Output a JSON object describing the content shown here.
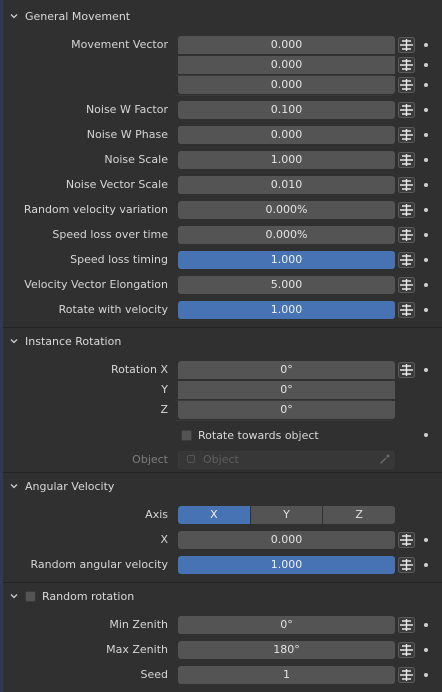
{
  "sections": {
    "general_movement": {
      "title": "General Movement",
      "movement_vector_label": "Movement Vector",
      "movement_vector": [
        "0.000",
        "0.000",
        "0.000"
      ],
      "noise_w_factor_label": "Noise W Factor",
      "noise_w_factor": "0.100",
      "noise_w_phase_label": "Noise W Phase",
      "noise_w_phase": "0.000",
      "noise_scale_label": "Noise Scale",
      "noise_scale": "1.000",
      "noise_vector_scale_label": "Noise Vector Scale",
      "noise_vector_scale": "0.010",
      "random_velocity_variation_label": "Random velocity variation",
      "random_velocity_variation": "0.000%",
      "speed_loss_over_time_label": "Speed loss over time",
      "speed_loss_over_time": "0.000%",
      "speed_loss_timing_label": "Speed loss timing",
      "speed_loss_timing": "1.000",
      "speed_loss_timing_fill": 1.0,
      "velocity_vector_elongation_label": "Velocity Vector Elongation",
      "velocity_vector_elongation": "5.000",
      "rotate_with_velocity_label": "Rotate with velocity",
      "rotate_with_velocity": "1.000",
      "rotate_with_velocity_fill": 1.0
    },
    "instance_rotation": {
      "title": "Instance Rotation",
      "rotation_x_label": "Rotation X",
      "rotation_x": "0°",
      "y_label": "Y",
      "rotation_y": "0°",
      "z_label": "Z",
      "rotation_z": "0°",
      "rotate_towards_object_label": "Rotate towards object",
      "rotate_towards_object_checked": false,
      "object_label": "Object",
      "object_placeholder": "Object"
    },
    "angular_velocity": {
      "title": "Angular Velocity",
      "axis_label": "Axis",
      "axis_options": [
        "X",
        "Y",
        "Z"
      ],
      "axis_selected": "X",
      "x_label": "X",
      "x_value": "0.000",
      "random_angular_velocity_label": "Random angular velocity",
      "random_angular_velocity": "1.000",
      "random_angular_velocity_fill": 1.0
    },
    "random_rotation": {
      "title": "Random rotation",
      "enabled": false,
      "min_zenith_label": "Min Zenith",
      "min_zenith": "0°",
      "max_zenith_label": "Max Zenith",
      "max_zenith": "180°",
      "seed_label": "Seed",
      "seed": "1"
    }
  },
  "icons": {
    "section_toggle": "chevron-down-icon",
    "animate": "keyframe-decorator-icon",
    "driver_dot": "driver-dot-icon",
    "eyedropper": "eyedropper-icon"
  },
  "colors": {
    "panel_bg": "#303030",
    "field_bg": "#545454",
    "accent_fill": "#4772b3",
    "text": "#d8d8d8"
  }
}
